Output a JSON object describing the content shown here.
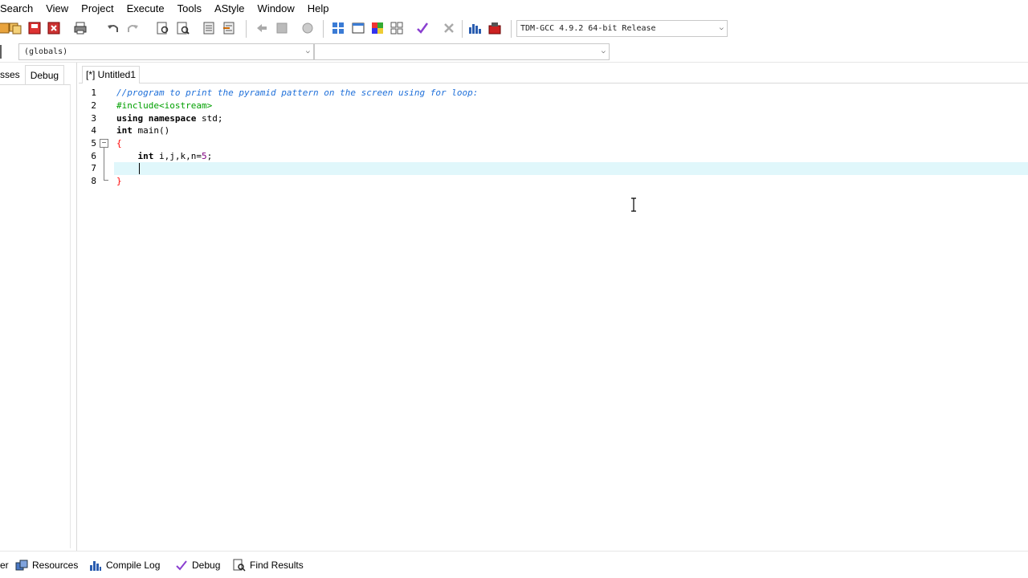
{
  "menu": {
    "items": [
      "Search",
      "View",
      "Project",
      "Execute",
      "Tools",
      "AStyle",
      "Window",
      "Help"
    ]
  },
  "toolbar": {
    "compiler": "TDM-GCC 4.9.2 64-bit Release"
  },
  "scope": {
    "left_value": "(globals)",
    "right_value": ""
  },
  "left_panel": {
    "tabs": [
      "sses",
      "Debug"
    ]
  },
  "editor": {
    "tab_label": "[*] Untitled1",
    "line_numbers": [
      "1",
      "2",
      "3",
      "4",
      "5",
      "6",
      "7",
      "8"
    ],
    "lines": [
      {
        "comment": "//program to print the pyramid pattern on the screen using for loop:"
      },
      {
        "pre": "#include<iostream>"
      },
      {
        "kw1": "using namespace",
        "rest": " std;"
      },
      {
        "kw1": "int",
        "rest": " main()"
      },
      {
        "brace": "{"
      },
      {
        "indent": "    ",
        "kw1": "int",
        "rest": " i,j,k,n=",
        "num": "5",
        "tail": ";"
      },
      {
        "indent": "    "
      },
      {
        "brace": "}"
      }
    ],
    "current_line": 7
  },
  "bottom_tabs": {
    "partial": "er",
    "items": [
      "Resources",
      "Compile Log",
      "Debug",
      "Find Results"
    ]
  },
  "icons": {
    "toolbar": [
      "new-project-icon",
      "open-icon",
      "save-all-icon",
      "close-icon",
      "print-icon",
      "undo-icon",
      "redo-icon",
      "find-icon",
      "replace-icon",
      "indent-icon",
      "unindent-icon",
      "goto-back-icon",
      "goto-forward-icon",
      "bookmark-icon",
      "compile-icon",
      "run-icon",
      "compile-run-icon",
      "rebuild-icon",
      "syntax-check-icon",
      "stop-icon",
      "chart-icon",
      "profile-icon"
    ]
  },
  "colors": {
    "current_line": "#e0f7fb",
    "comment": "#1e6fd9",
    "preprocessor": "#00a000",
    "brace": "#ff0000",
    "number": "#800080"
  }
}
